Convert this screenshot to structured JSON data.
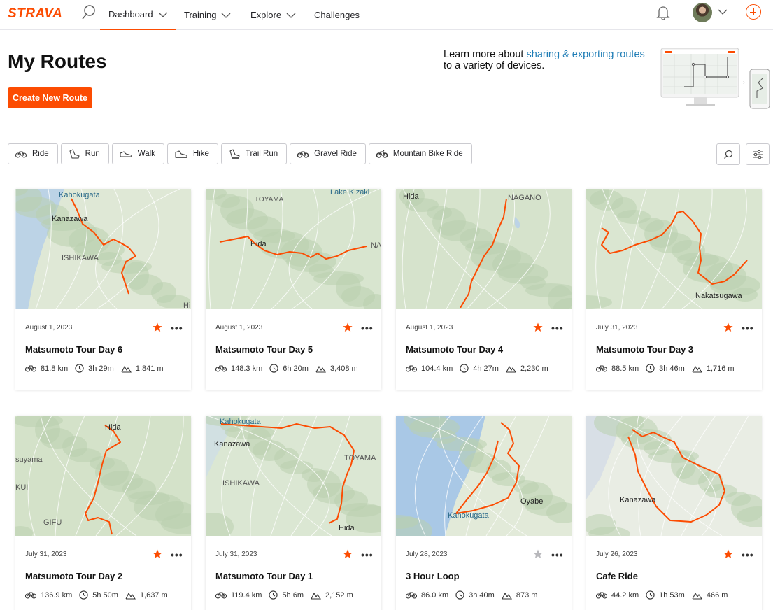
{
  "brand": {
    "logo": "STRAVA",
    "accent": "#fc4c02",
    "link_color": "#1f7db6"
  },
  "nav": {
    "items": [
      {
        "label": "Dashboard",
        "dropdown": true,
        "active": true
      },
      {
        "label": "Training",
        "dropdown": true,
        "active": false
      },
      {
        "label": "Explore",
        "dropdown": true,
        "active": false
      },
      {
        "label": "Challenges",
        "dropdown": false,
        "active": false
      }
    ],
    "icons": [
      "search-icon",
      "bell-icon",
      "avatar",
      "plus-circle-icon"
    ]
  },
  "header": {
    "title": "My Routes",
    "create_button": "Create New Route",
    "learn_prefix": "Learn more about ",
    "learn_link": "sharing & exporting routes",
    "learn_suffix": "to a variety of devices."
  },
  "filters": [
    {
      "label": "Ride",
      "icon": "bike-icon"
    },
    {
      "label": "Run",
      "icon": "shoe-icon"
    },
    {
      "label": "Walk",
      "icon": "walk-icon"
    },
    {
      "label": "Hike",
      "icon": "hike-icon"
    },
    {
      "label": "Trail Run",
      "icon": "trail-run-icon"
    },
    {
      "label": "Gravel Ride",
      "icon": "gravel-bike-icon"
    },
    {
      "label": "Mountain Bike Ride",
      "icon": "mtb-icon"
    }
  ],
  "routes": [
    {
      "date": "August 1, 2023",
      "title": "Matsumoto Tour Day 6",
      "distance": "81.8 km",
      "time": "3h 29m",
      "elevation": "1,841 m",
      "starred": true,
      "map_labels": [
        "Kahokugata",
        "Kanazawa",
        "ISHIKAWA",
        "Hi"
      ]
    },
    {
      "date": "August 1, 2023",
      "title": "Matsumoto Tour Day 5",
      "distance": "148.3 km",
      "time": "6h 20m",
      "elevation": "3,408 m",
      "starred": true,
      "map_labels": [
        "TOYAMA",
        "Lake Kizaki",
        "Hida",
        "NA"
      ]
    },
    {
      "date": "August 1, 2023",
      "title": "Matsumoto Tour Day 4",
      "distance": "104.4 km",
      "time": "4h 27m",
      "elevation": "2,230 m",
      "starred": true,
      "map_labels": [
        "Hida",
        "NAGANO"
      ]
    },
    {
      "date": "July 31, 2023",
      "title": "Matsumoto Tour Day 3",
      "distance": "88.5 km",
      "time": "3h 46m",
      "elevation": "1,716 m",
      "starred": true,
      "map_labels": [
        "Nakatsugawa"
      ]
    },
    {
      "date": "July 31, 2023",
      "title": "Matsumoto Tour Day 2",
      "distance": "136.9 km",
      "time": "5h 50m",
      "elevation": "1,637 m",
      "starred": true,
      "map_labels": [
        "Hida",
        "suyama",
        "KUI",
        "GIFU"
      ]
    },
    {
      "date": "July 31, 2023",
      "title": "Matsumoto Tour Day 1",
      "distance": "119.4 km",
      "time": "5h 6m",
      "elevation": "2,152 m",
      "starred": true,
      "map_labels": [
        "Kahokugata",
        "Kanazawa",
        "ISHIKAWA",
        "TOYAMA",
        "Hida"
      ]
    },
    {
      "date": "July 28, 2023",
      "title": "3 Hour Loop",
      "distance": "86.0 km",
      "time": "3h 40m",
      "elevation": "873 m",
      "starred": false,
      "map_labels": [
        "Oyabe",
        "Kahokugata"
      ]
    },
    {
      "date": "July 26, 2023",
      "title": "Cafe Ride",
      "distance": "44.2 km",
      "time": "1h 53m",
      "elevation": "466 m",
      "starred": true,
      "map_labels": [
        "Kanazawa"
      ]
    }
  ]
}
